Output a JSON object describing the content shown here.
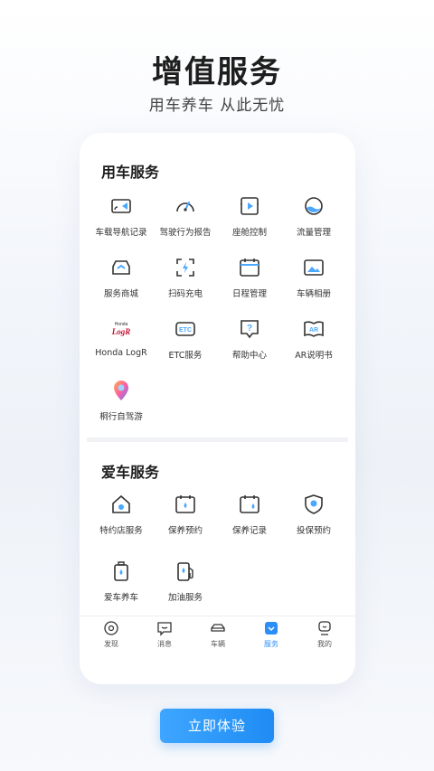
{
  "hero": {
    "title": "增值服务",
    "subtitle": "用车养车  从此无忧"
  },
  "section1": {
    "title": "用车服务",
    "items": [
      {
        "label": "车载导航记录",
        "icon": "nav-record-icon"
      },
      {
        "label": "驾驶行为报告",
        "icon": "gauge-icon"
      },
      {
        "label": "座舱控制",
        "icon": "cockpit-icon"
      },
      {
        "label": "流量管理",
        "icon": "data-flow-icon"
      },
      {
        "label": "服务商城",
        "icon": "mall-icon"
      },
      {
        "label": "扫码充电",
        "icon": "scan-charge-icon"
      },
      {
        "label": "日程管理",
        "icon": "calendar-icon"
      },
      {
        "label": "车辆相册",
        "icon": "album-icon"
      },
      {
        "label": "Honda LogR",
        "icon": "honda-logr-logo",
        "logo_top": "Honda",
        "logo_main": "LogR"
      },
      {
        "label": "ETC服务",
        "icon": "etc-icon",
        "glyph": "ETC"
      },
      {
        "label": "帮助中心",
        "icon": "help-icon",
        "glyph": "?"
      },
      {
        "label": "AR说明书",
        "icon": "ar-manual-icon",
        "glyph": "AR"
      },
      {
        "label": "桐行自驾游",
        "icon": "map-pin-icon"
      }
    ]
  },
  "section2": {
    "title": "爱车服务",
    "items": [
      {
        "label": "特约店服务",
        "icon": "dealer-icon"
      },
      {
        "label": "保养预约",
        "icon": "maintenance-booking-icon"
      },
      {
        "label": "保养记录",
        "icon": "maintenance-record-icon"
      },
      {
        "label": "投保预约",
        "icon": "insurance-icon"
      },
      {
        "label": "爱车养车",
        "icon": "car-care-icon"
      },
      {
        "label": "加油服务",
        "icon": "fuel-icon"
      }
    ]
  },
  "tabs": [
    {
      "label": "发现",
      "icon": "discover-icon"
    },
    {
      "label": "消息",
      "icon": "message-icon"
    },
    {
      "label": "车辆",
      "icon": "car-icon"
    },
    {
      "label": "服务",
      "icon": "service-icon",
      "active": true
    },
    {
      "label": "我的",
      "icon": "profile-icon"
    }
  ],
  "cta": {
    "label": "立即体验"
  },
  "colors": {
    "accent": "#2c8ef8",
    "icon_stroke": "#333333",
    "icon_fill": "#4aa8ff"
  }
}
